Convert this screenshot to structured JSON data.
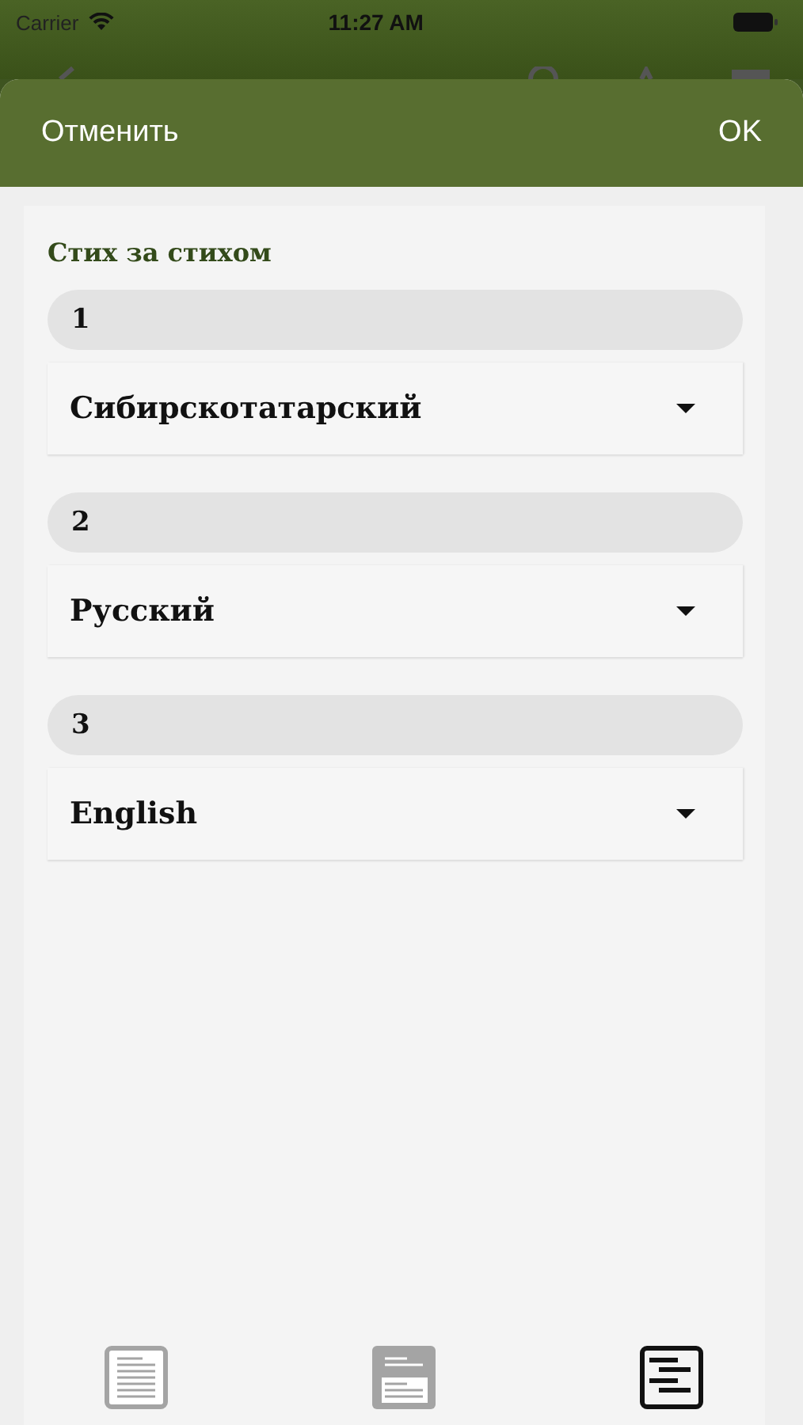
{
  "status_bar": {
    "carrier": "Carrier",
    "time": "11:27 AM"
  },
  "sheet": {
    "cancel": "Отменить",
    "ok": "OK"
  },
  "section_title": "Стих за стихом",
  "slots": [
    {
      "number": "1",
      "language": "Сибирскотатарский"
    },
    {
      "number": "2",
      "language": "Русский"
    },
    {
      "number": "3",
      "language": "English"
    }
  ],
  "modes": [
    {
      "kind": "single",
      "selected": false
    },
    {
      "kind": "split",
      "selected": false
    },
    {
      "kind": "interlinear",
      "selected": true
    }
  ]
}
